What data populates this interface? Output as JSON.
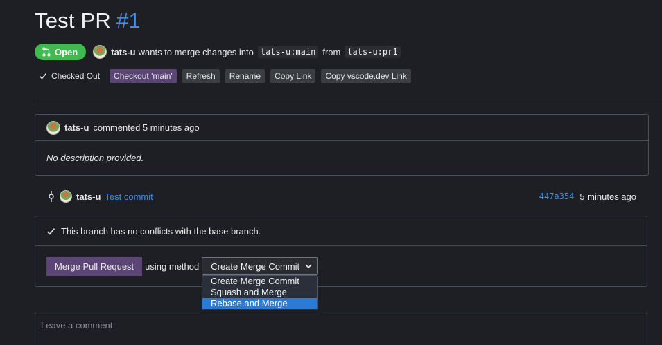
{
  "pr": {
    "title": "Test PR",
    "number": "#1"
  },
  "status": {
    "badge": "Open",
    "author": "tats-u",
    "text": "wants to merge changes into",
    "target_branch": "tats-u:main",
    "from_text": "from",
    "source_branch": "tats-u:pr1"
  },
  "actions": {
    "checked_out": "Checked Out",
    "checkout": "Checkout 'main'",
    "refresh": "Refresh",
    "rename": "Rename",
    "copy_link": "Copy Link",
    "copy_vscode": "Copy vscode.dev Link"
  },
  "comment": {
    "author": "tats-u",
    "meta": "commented 5 minutes ago",
    "body": "No description provided."
  },
  "commit": {
    "author": "tats-u",
    "message": "Test commit",
    "sha": "447a354",
    "time": "5 minutes ago"
  },
  "merge": {
    "status": "This branch has no conflicts with the base branch.",
    "button": "Merge Pull Request",
    "using_text": "using method",
    "selected": "Create Merge Commit",
    "options": [
      "Create Merge Commit",
      "Squash and Merge",
      "Rebase and Merge"
    ]
  },
  "new_comment": {
    "placeholder": "Leave a comment"
  },
  "colors": {
    "accent": "#3b8eea",
    "open": "#3fb950",
    "primary_button": "#5a4575",
    "highlight": "#2a7bd6"
  }
}
